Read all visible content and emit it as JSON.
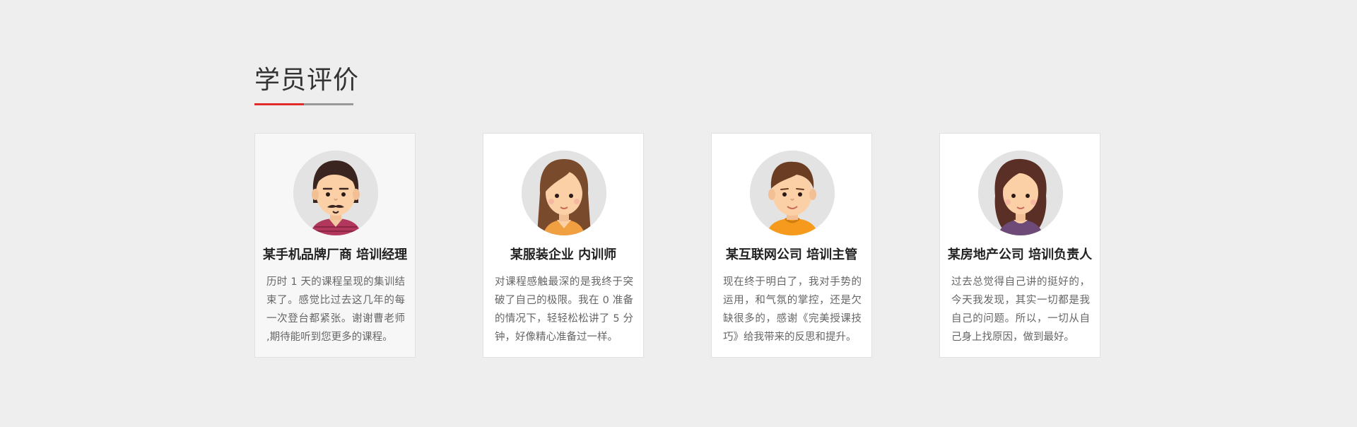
{
  "section": {
    "title": "学员评价"
  },
  "colors": {
    "background": "#eeeeee",
    "accent": "#e22b2b",
    "underline_gray": "#999999",
    "card_background": "#ffffff",
    "card_highlight_background": "#f7f7f7",
    "avatar_ring": "#e3e3e3"
  },
  "testimonials": [
    {
      "avatar": "male-avatar-mustache-icon",
      "name": "某手机品牌厂商 培训经理",
      "quote": "历时 1 天的课程呈现的集训结束了。感觉比过去这几年的每一次登台都紧张。谢谢曹老师 ,期待能听到您更多的课程。"
    },
    {
      "avatar": "female-avatar-long-hair-icon",
      "name": "某服装企业 内训师",
      "quote": "对课程感触最深的是我终于突破了自己的极限。我在 0 准备的情况下，轻轻松松讲了 5 分钟，好像精心准备过一样。"
    },
    {
      "avatar": "male-avatar-short-hair-icon",
      "name": "某互联网公司 培训主管",
      "quote": "现在终于明白了，我对手势的运用，和气氛的掌控，还是欠缺很多的，感谢《完美授课技巧》给我带来的反思和提升。"
    },
    {
      "avatar": "female-avatar-wavy-hair-icon",
      "name": "某房地产公司 培训负责人",
      "quote": "过去总觉得自己讲的挺好的，今天我发现，其实一切都是我自己的问题。所以，一切从自己身上找原因，做到最好。"
    }
  ]
}
